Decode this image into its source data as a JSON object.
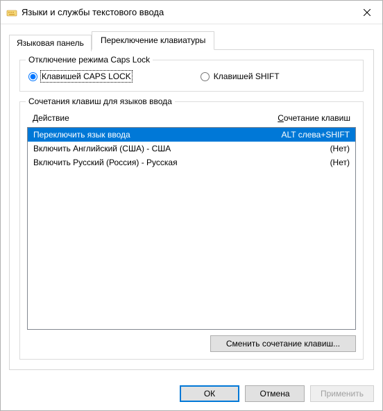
{
  "window": {
    "title": "Языки и службы текстового ввода"
  },
  "tabs": {
    "language_panel": "Языковая панель",
    "keyboard_switch": "Переключение клавиатуры"
  },
  "capslock_group": {
    "legend": "Отключение режима Caps Lock",
    "option_capslock": "Клавишей CAPS LOCK",
    "option_shift": "Клавишей SHIFT"
  },
  "hotkeys_group": {
    "legend": "Сочетания клавиш для языков ввода",
    "col_action": "Действие",
    "col_shortcut": "Сочетание клавиш",
    "rows": [
      {
        "action": "Переключить язык ввода",
        "shortcut": "ALT слева+SHIFT"
      },
      {
        "action": "Включить Английский (США) - США",
        "shortcut": "(Нет)"
      },
      {
        "action": "Включить Русский (Россия) - Русская",
        "shortcut": "(Нет)"
      }
    ],
    "change_button": "Сменить сочетание клавиш..."
  },
  "buttons": {
    "ok": "ОК",
    "cancel": "Отмена",
    "apply": "Применить"
  }
}
